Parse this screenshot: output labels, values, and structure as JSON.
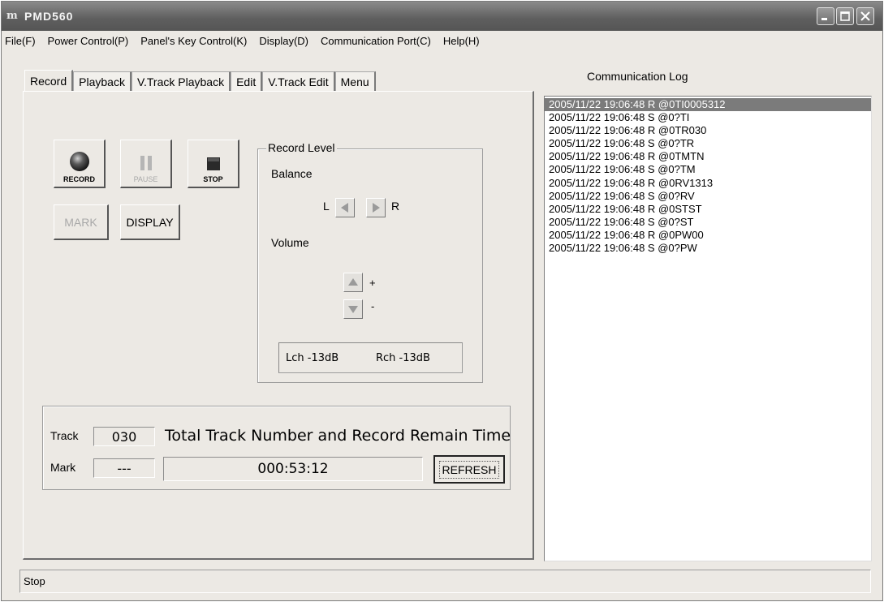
{
  "window": {
    "logo": "m",
    "title": "PMD560"
  },
  "menu": [
    "File(F)",
    "Power Control(P)",
    "Panel's Key Control(K)",
    "Display(D)",
    "Communication Port(C)",
    "Help(H)"
  ],
  "tabs": [
    {
      "label": "Record",
      "active": true
    },
    {
      "label": "Playback"
    },
    {
      "label": "V.Track Playback"
    },
    {
      "label": "Edit"
    },
    {
      "label": "V.Track Edit"
    },
    {
      "label": "Menu"
    }
  ],
  "transport": {
    "record": "RECORD",
    "pause": "PAUSE",
    "stop": "STOP",
    "mark": "MARK",
    "display": "DISPLAY"
  },
  "record_level": {
    "legend": "Record Level",
    "balance_label": "Balance",
    "left_label": "L",
    "right_label": "R",
    "volume_label": "Volume",
    "plus": "+",
    "minus": "-",
    "lch": "Lch -13dB",
    "rch": "Rch -13dB"
  },
  "track_info": {
    "track_label": "Track",
    "track_value": "030",
    "caption": "Total Track Number and Record Remain Time",
    "mark_label": "Mark",
    "mark_value": "---",
    "remain_time": "000:53:12",
    "refresh": "REFRESH"
  },
  "log": {
    "title": "Communication Log",
    "lines": [
      "2005/11/22 19:06:48  R @0TI0005312",
      "2005/11/22 19:06:48 S @0?TI",
      "2005/11/22 19:06:48  R @0TR030",
      "2005/11/22 19:06:48 S @0?TR",
      "2005/11/22 19:06:48  R @0TMTN",
      "2005/11/22 19:06:48 S @0?TM",
      "2005/11/22 19:06:48  R @0RV1313",
      "2005/11/22 19:06:48 S @0?RV",
      "2005/11/22 19:06:48  R @0STST",
      "2005/11/22 19:06:48 S @0?ST",
      "2005/11/22 19:06:48  R @0PW00",
      "2005/11/22 19:06:48 S @0?PW"
    ]
  },
  "status": {
    "text": "Stop"
  }
}
